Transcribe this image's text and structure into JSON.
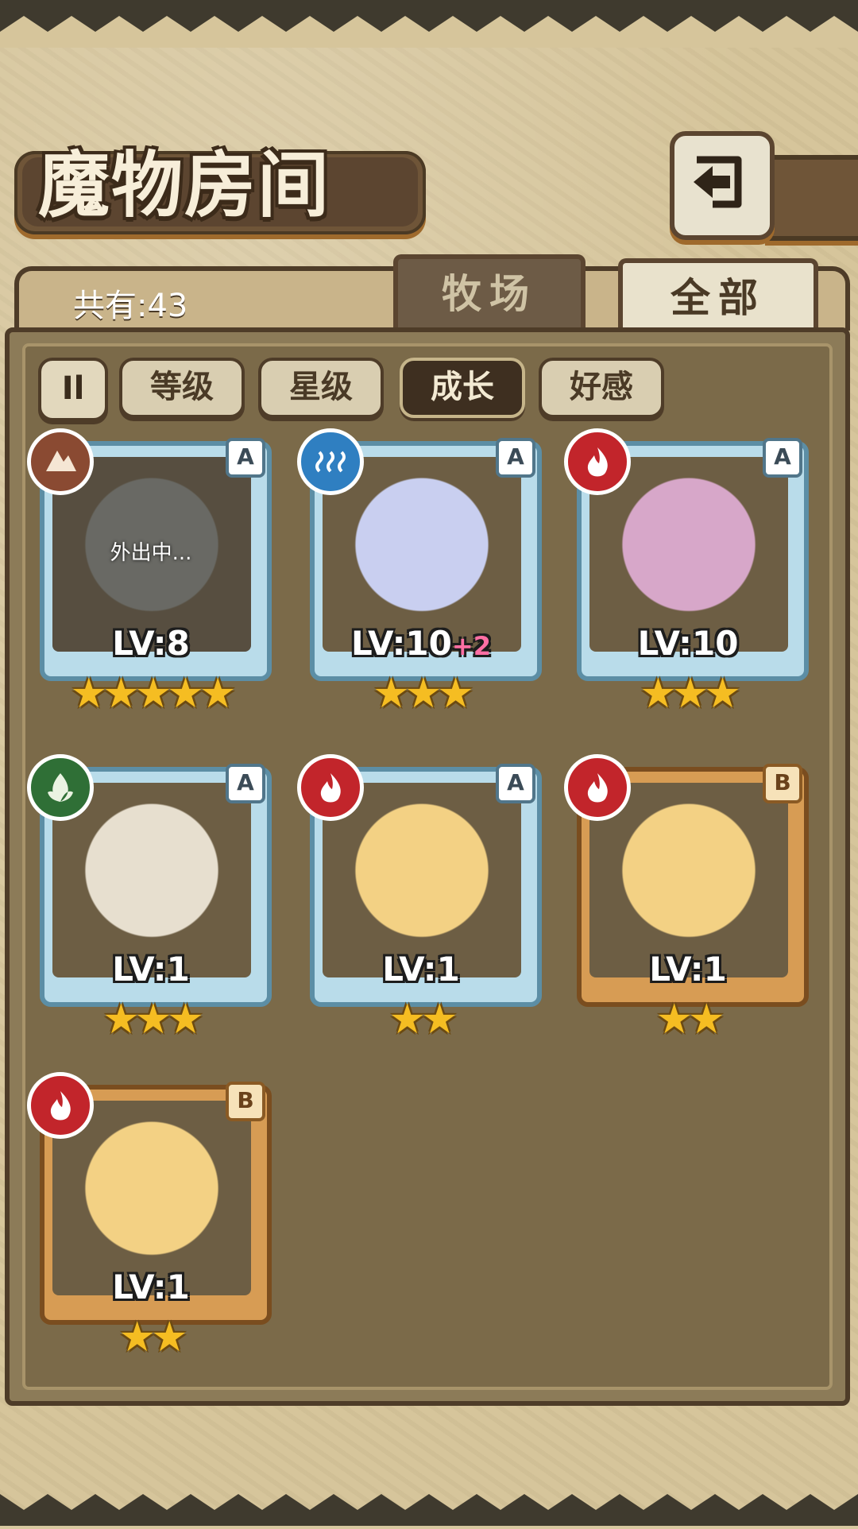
{
  "title": "魔物房间",
  "count_label": "共有:43",
  "tabs": [
    {
      "label": "牧场",
      "active": false
    },
    {
      "label": "全部",
      "active": true
    }
  ],
  "sort_button": {
    "label": "Il"
  },
  "filters": [
    {
      "label": "等级",
      "active": false
    },
    {
      "label": "星级",
      "active": false
    },
    {
      "label": "成长",
      "active": true
    },
    {
      "label": "好感",
      "active": false
    }
  ],
  "monsters": [
    {
      "rank": "A",
      "element": "earth",
      "elem_color": "#8a4a32",
      "level": "LV:8",
      "bonus": "",
      "stars": 5,
      "status": "外出中...",
      "art": "dark-armored-girl",
      "art_color": "#8f8f86"
    },
    {
      "rank": "A",
      "element": "water",
      "elem_color": "#2f7fc1",
      "level": "LV:10",
      "bonus": "+2",
      "stars": 3,
      "status": "",
      "art": "crystal-fairy",
      "art_color": "#c9cff0"
    },
    {
      "rank": "A",
      "element": "fire",
      "elem_color": "#c2252b",
      "level": "LV:10",
      "bonus": "",
      "stars": 3,
      "status": "",
      "art": "mushroom-girl",
      "art_color": "#d7a7c9"
    },
    {
      "rank": "A",
      "element": "wood",
      "elem_color": "#2f6f36",
      "level": "LV:1",
      "bonus": "",
      "stars": 3,
      "status": "",
      "art": "lotus-girl",
      "art_color": "#e7dfcf"
    },
    {
      "rank": "A",
      "element": "fire",
      "elem_color": "#c2252b",
      "level": "LV:1",
      "bonus": "",
      "stars": 2,
      "status": "",
      "art": "pudding-slime",
      "art_color": "#f3d184"
    },
    {
      "rank": "B",
      "element": "fire",
      "elem_color": "#c2252b",
      "level": "LV:1",
      "bonus": "",
      "stars": 2,
      "status": "",
      "art": "pudding-slime",
      "art_color": "#f3d184"
    },
    {
      "rank": "B",
      "element": "fire",
      "elem_color": "#c2252b",
      "level": "LV:1",
      "bonus": "",
      "stars": 2,
      "status": "",
      "art": "pudding-slime",
      "art_color": "#f3d184"
    }
  ]
}
